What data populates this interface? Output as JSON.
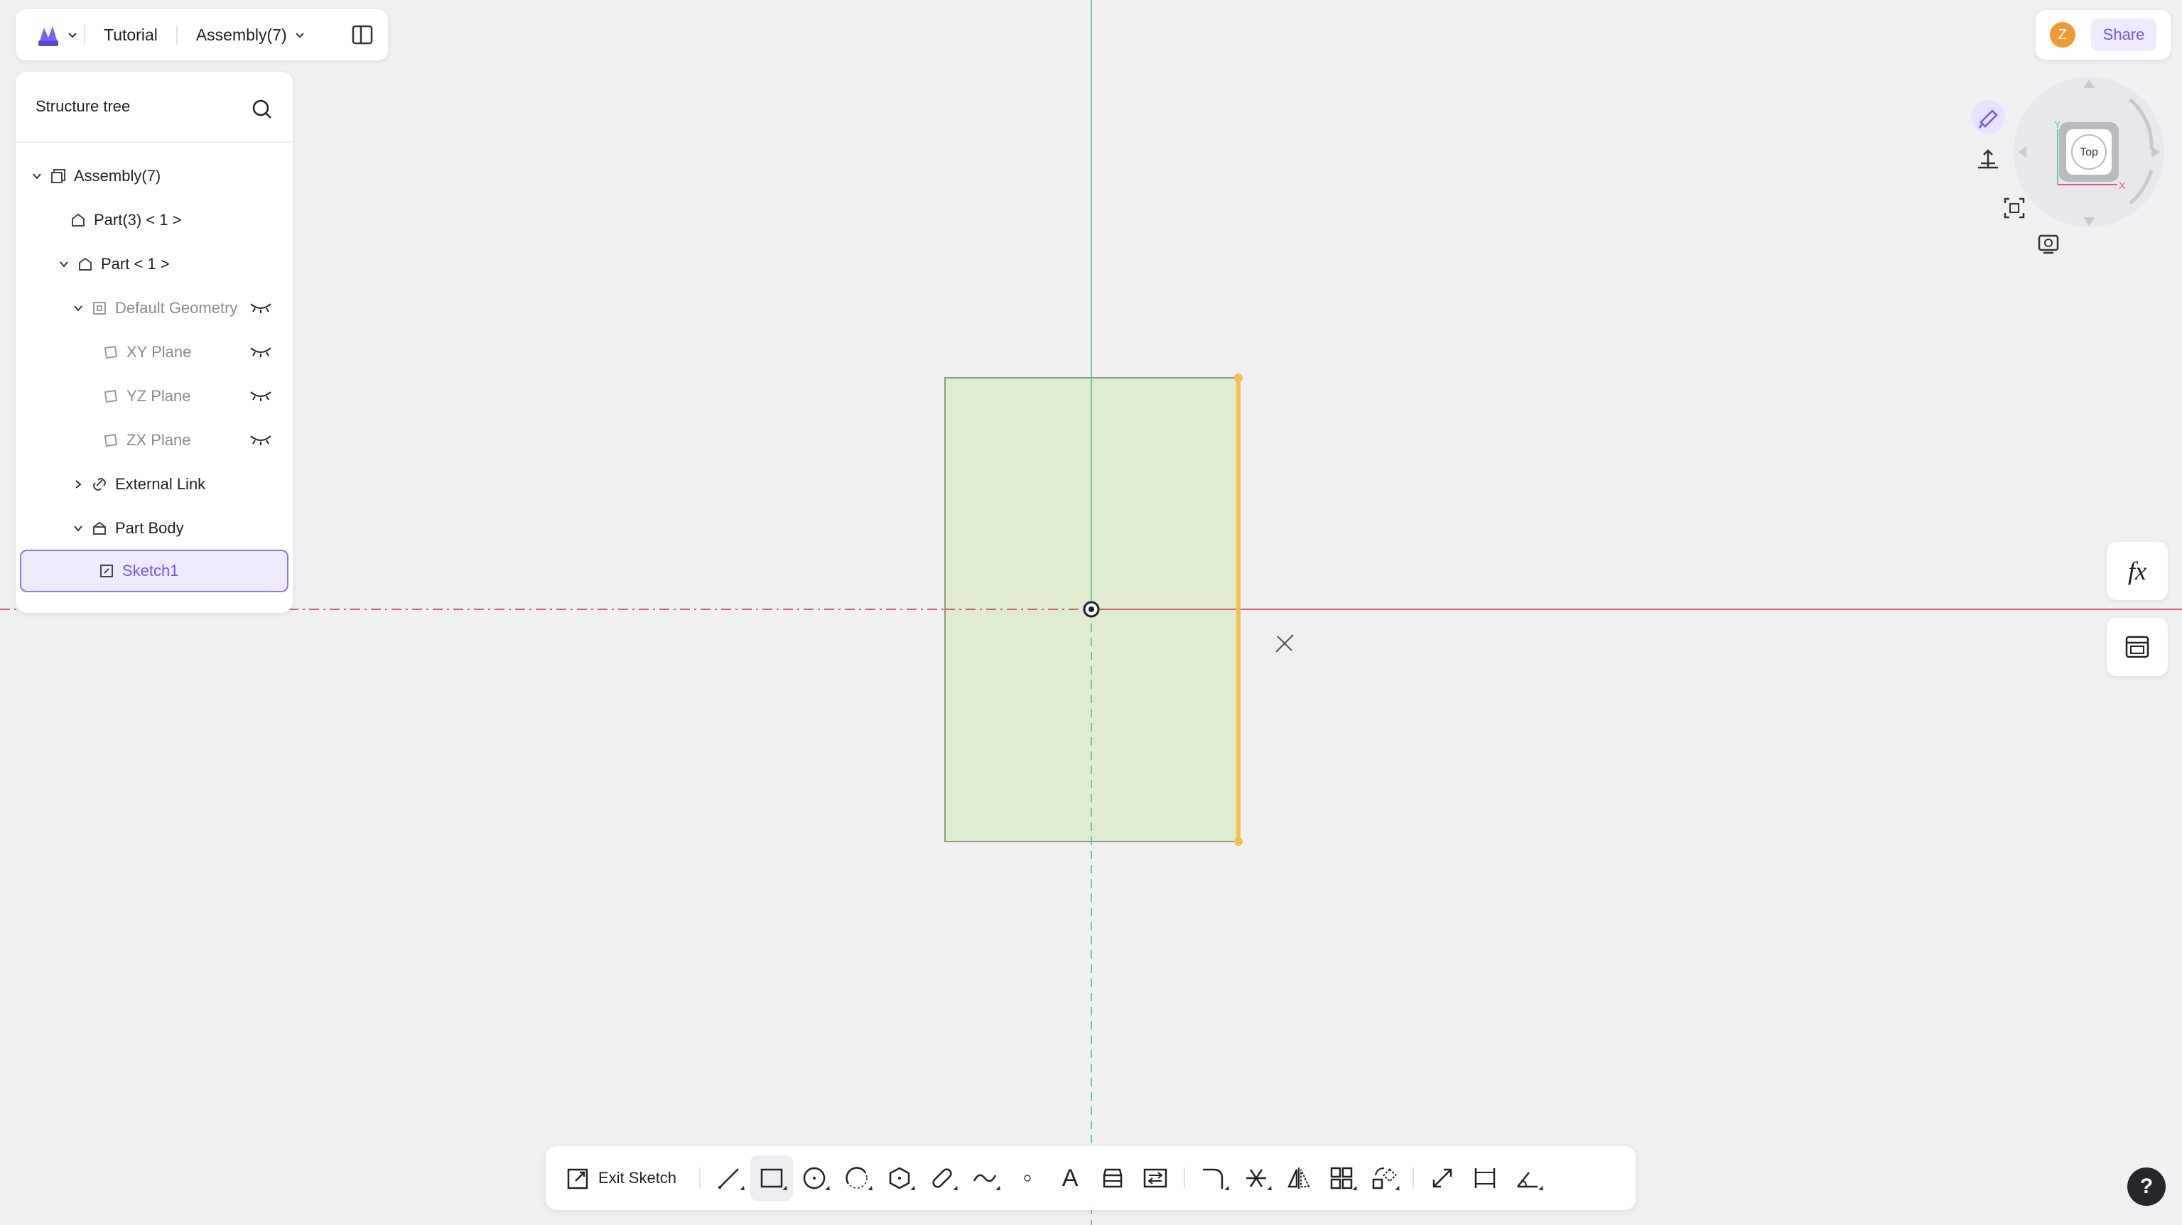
{
  "topbar": {
    "tutorial": "Tutorial",
    "assembly": "Assembly(7)"
  },
  "tree": {
    "title": "Structure tree",
    "items": [
      {
        "label": "Assembly(7)"
      },
      {
        "label": "Part(3) < 1 >"
      },
      {
        "label": "Part < 1 >"
      },
      {
        "label": "Default Geometry"
      },
      {
        "label": "XY Plane"
      },
      {
        "label": "YZ Plane"
      },
      {
        "label": "ZX Plane"
      },
      {
        "label": "External Link"
      },
      {
        "label": "Part Body"
      },
      {
        "label": "Sketch1"
      }
    ]
  },
  "header_right": {
    "avatar": "Z",
    "share": "Share"
  },
  "view_cube": {
    "face": "Top",
    "axis_y": "Y",
    "axis_x": "X"
  },
  "right_panel": {
    "formula": "fx"
  },
  "toolbar": {
    "exit_sketch": "Exit Sketch",
    "text_tool": "A"
  },
  "help": "?",
  "colors": {
    "accent": "#7357e8",
    "sketch_fill": "#dfeccf",
    "highlight_edge": "#f5c04a",
    "x_axis": "#e05b75",
    "y_axis": "#6cc8a1"
  }
}
